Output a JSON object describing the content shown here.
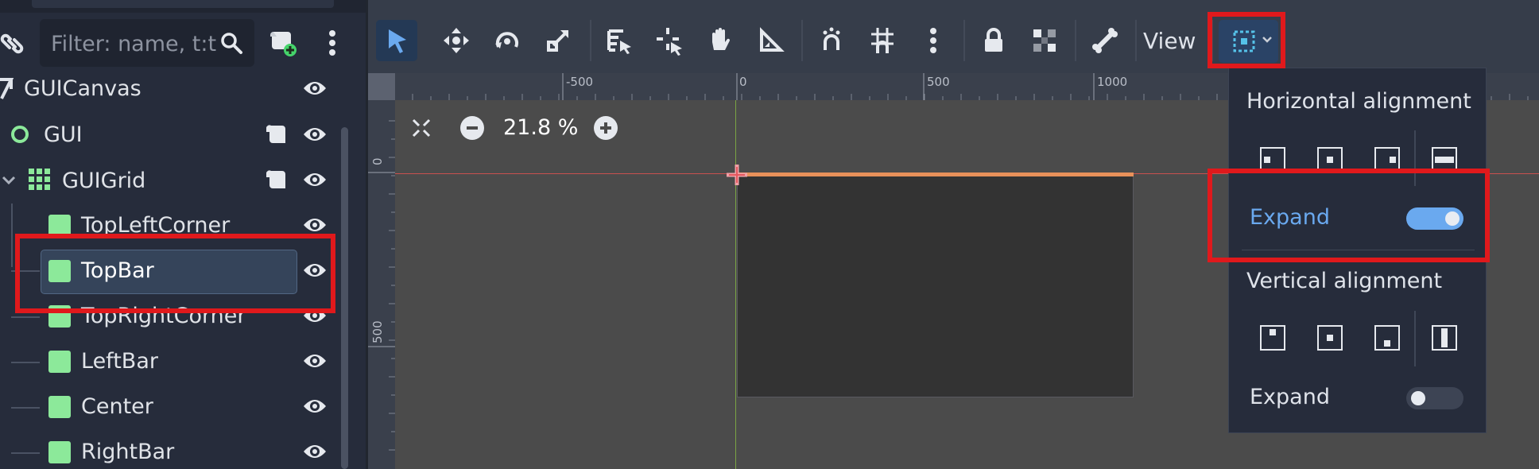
{
  "scene_dock": {
    "filter_placeholder": "Filter: name, t:t",
    "nodes": [
      {
        "label": "GUICanvas",
        "icon": "canvas-layer-icon"
      },
      {
        "label": "GUI",
        "icon": "control-circle-icon"
      },
      {
        "label": "GUIGrid",
        "icon": "grid-container-icon"
      },
      {
        "label": "TopLeftCorner",
        "icon": "nine-patch-icon"
      },
      {
        "label": "TopBar",
        "icon": "nine-patch-icon",
        "selected": true
      },
      {
        "label": "TopRightCorner",
        "icon": "nine-patch-icon"
      },
      {
        "label": "LeftBar",
        "icon": "nine-patch-icon"
      },
      {
        "label": "Center",
        "icon": "nine-patch-icon"
      },
      {
        "label": "RightBar",
        "icon": "nine-patch-icon"
      }
    ]
  },
  "toolbar": {
    "view_label": "View",
    "tools": [
      "select-icon",
      "move-icon",
      "rotate-icon",
      "scale-icon",
      "list-select-icon",
      "pivot-icon",
      "pan-icon",
      "ruler-icon",
      "smart-snap-icon",
      "grid-snap-icon",
      "more-icon",
      "lock-icon",
      "group-icon",
      "bone-icon"
    ]
  },
  "canvas": {
    "zoom_label": "21.8 %",
    "ruler_top": [
      "-500",
      "0",
      "500",
      "1000"
    ],
    "ruler_left": [
      "0",
      "500"
    ]
  },
  "container_sizing_popup": {
    "horizontal_title": "Horizontal alignment",
    "horizontal_expand_label": "Expand",
    "horizontal_expand_on": true,
    "vertical_title": "Vertical alignment",
    "vertical_expand_label": "Expand",
    "vertical_expand_on": false
  },
  "colors": {
    "accent": "#6aa9ef",
    "highlight": "#e0191c",
    "node_green": "#8ce99a",
    "selected_row": "#35445a"
  }
}
